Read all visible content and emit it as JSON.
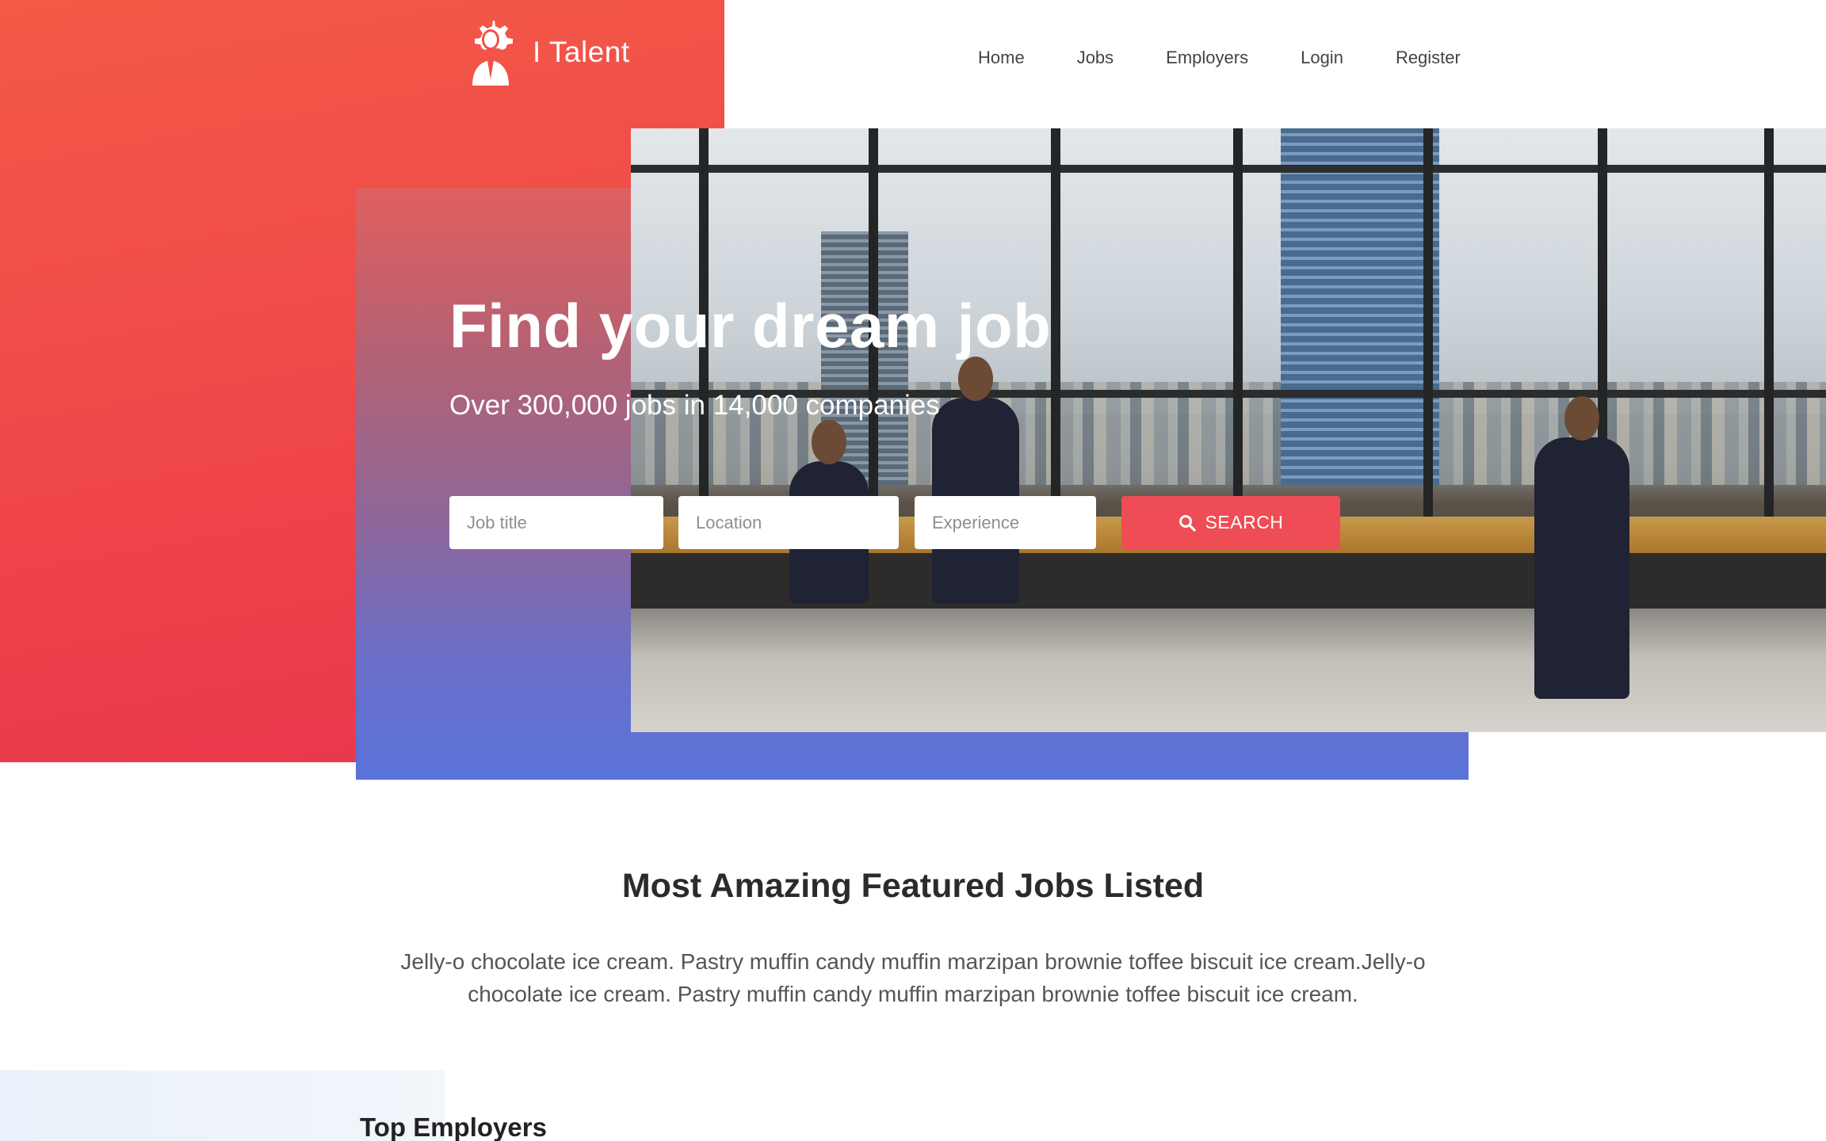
{
  "brand": {
    "name": "I Talent",
    "logo_icon": "person-gear-icon"
  },
  "nav": {
    "items": [
      {
        "label": "Home"
      },
      {
        "label": "Jobs"
      },
      {
        "label": "Employers"
      },
      {
        "label": "Login"
      },
      {
        "label": "Register"
      }
    ]
  },
  "hero": {
    "title": "Find your dream job",
    "subtitle": "Over 300,000 jobs in 14,000 companies",
    "search": {
      "job_title_placeholder": "Job title",
      "location_placeholder": "Location",
      "experience_placeholder": "Experience",
      "button_label": "SEARCH",
      "button_icon": "search-icon"
    }
  },
  "featured": {
    "title": "Most Amazing Featured Jobs Listed",
    "description": "Jelly-o chocolate ice cream. Pastry muffin candy muffin marzipan brownie toffee biscuit ice cream.Jelly-o chocolate ice cream. Pastry muffin candy muffin marzipan brownie toffee biscuit ice cream."
  },
  "employers": {
    "title": "Top Employers"
  },
  "colors": {
    "accent_red": "#ef4d56",
    "panel_red": "#ef4649",
    "gradient_blue": "#5a73da"
  }
}
